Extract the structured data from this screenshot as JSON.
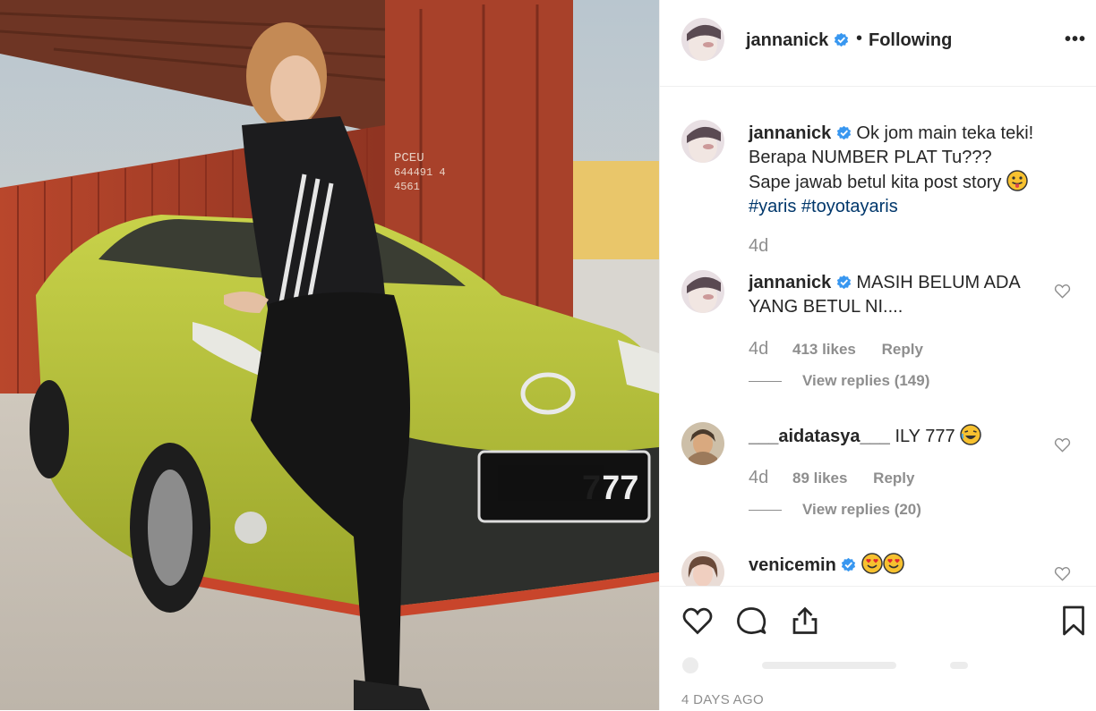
{
  "post": {
    "author": "jannanick",
    "follow_status": "Following",
    "dot": "•",
    "more": "•••",
    "timestamp": "4 DAYS AGO"
  },
  "caption": {
    "username": "jannanick",
    "line1": "Ok jom main teka teki!",
    "line2": "Berapa NUMBER PLAT Tu???",
    "line3": "Sape jawab betul kita post story",
    "hashtag1": "#yaris",
    "hashtag2": "#toyotayaris",
    "age": "4d"
  },
  "comments": [
    {
      "username": "jannanick",
      "text_line1": "MASIH BELUM ADA",
      "text_line2": "YANG BETUL NI....",
      "age": "4d",
      "likes": "413 likes",
      "reply": "Reply",
      "view_replies": "View replies (149)"
    },
    {
      "username": "___aidatasya___",
      "text": "ILY 777",
      "age": "4d",
      "likes": "89 likes",
      "reply": "Reply",
      "view_replies": "View replies (20)"
    },
    {
      "username": "venicemin",
      "text": ""
    }
  ],
  "photo": {
    "plate_text": "777",
    "container_text": "PCEU 644491 4 4561"
  },
  "colors": {
    "verified": "#3897f0",
    "hashtag": "#00376b",
    "muted": "#8e8e8e",
    "car": "#b5c33a",
    "container": "#b5452d"
  },
  "icons": [
    "heart-icon",
    "comment-icon",
    "share-icon",
    "bookmark-icon",
    "verified-icon",
    "more-icon"
  ]
}
